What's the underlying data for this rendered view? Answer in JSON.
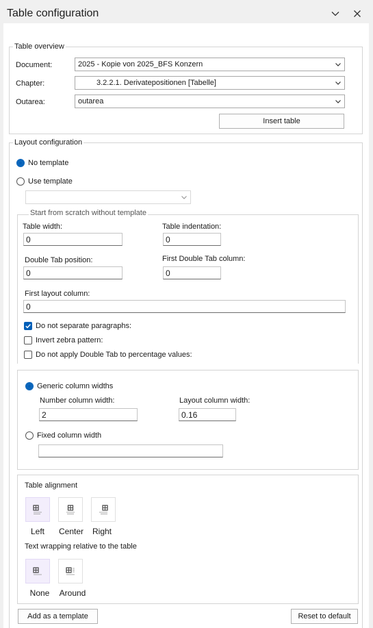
{
  "pane": {
    "title": "Table configuration"
  },
  "overview": {
    "legend": "Table overview",
    "document_label": "Document:",
    "document_value": "2025 - Kopie von 2025_BFS Konzern",
    "chapter_label": "Chapter:",
    "chapter_value": "3.2.2.1. Derivatepositionen [Tabelle]",
    "outarea_label": "Outarea:",
    "outarea_value": "outarea",
    "insert_button": "Insert table"
  },
  "layout": {
    "legend": "Layout configuration",
    "no_template": "No template",
    "use_template": "Use template",
    "template_value": "",
    "scratch": {
      "legend": "Start from scratch without template",
      "table_width_label": "Table width:",
      "table_width": "0",
      "table_indent_label": "Table indentation:",
      "table_indent": "0",
      "double_tab_label": "Double Tab position:",
      "double_tab": "0",
      "first_double_col_label": "First Double Tab column:",
      "first_double_col": "0",
      "first_layout_col_label": "First layout column:",
      "first_layout_col": "0",
      "no_separate": "Do not separate paragraphs:",
      "invert_zebra": "Invert zebra pattern:",
      "no_double_tab_pct": "Do not apply Double Tab to percentage values:"
    },
    "columns": {
      "generic_label": "Generic column widths",
      "number_col_label": "Number column width:",
      "number_col": "2",
      "layout_col_label": "Layout column width:",
      "layout_col": "0.16",
      "fixed_label": "Fixed column width",
      "fixed_value": ""
    },
    "alignment": {
      "title": "Table alignment",
      "options": [
        "Left",
        "Center",
        "Right"
      ],
      "wrap_title": "Text wrapping relative to the table",
      "wrap_options": [
        "None",
        "Around"
      ]
    }
  },
  "footer": {
    "add_template": "Add as a template",
    "reset": "Reset to default"
  },
  "colors": {
    "accent": "#005fb8",
    "selected_bg": "#f3eefc"
  }
}
